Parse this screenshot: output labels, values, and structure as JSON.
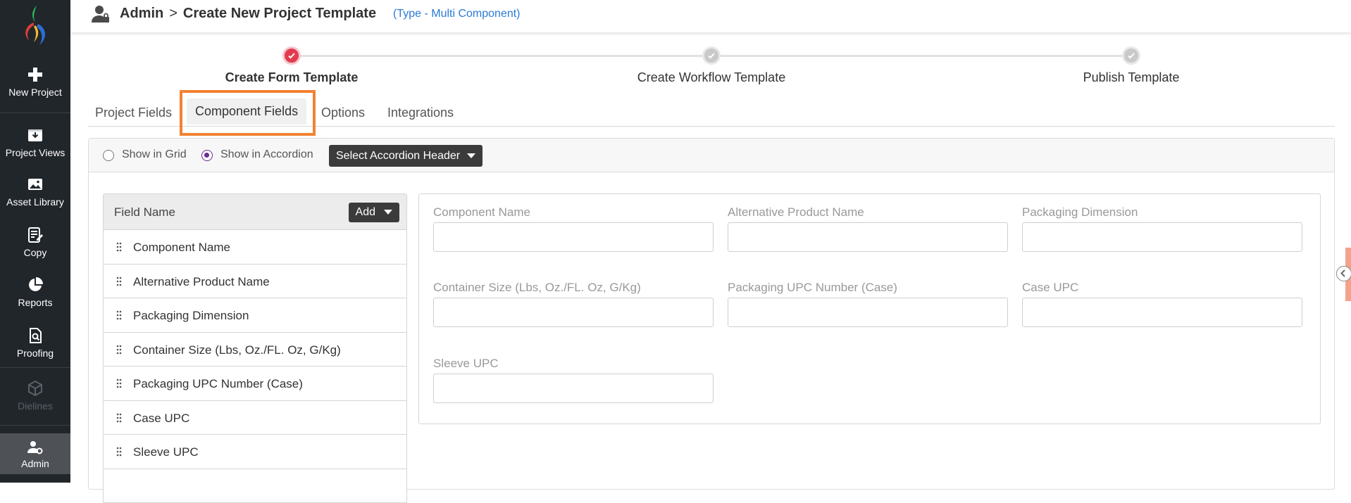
{
  "sidebar": {
    "items": [
      {
        "label": "New Project",
        "icon": "plus-icon"
      },
      {
        "label": "Project Views",
        "icon": "download-box-icon"
      },
      {
        "label": "Asset Library",
        "icon": "image-icon"
      },
      {
        "label": "Copy",
        "icon": "edit-document-icon"
      },
      {
        "label": "Reports",
        "icon": "pie-chart-icon"
      },
      {
        "label": "Proofing",
        "icon": "document-search-icon"
      },
      {
        "label": "Dielines",
        "icon": "box-icon"
      },
      {
        "label": "Admin",
        "icon": "user-gear-icon"
      }
    ]
  },
  "header": {
    "section": "Admin",
    "separator": ">",
    "title": "Create New Project Template",
    "type": "(Type - Multi Component)"
  },
  "stepper": {
    "steps": [
      {
        "label": "Create Form Template",
        "state": "done"
      },
      {
        "label": "Create Workflow Template",
        "state": "pending"
      },
      {
        "label": "Publish Template",
        "state": "pending"
      }
    ]
  },
  "tabs": [
    {
      "label": "Project Fields"
    },
    {
      "label": "Component Fields"
    },
    {
      "label": "Options"
    },
    {
      "label": "Integrations"
    }
  ],
  "toolbar": {
    "grid_label": "Show in Grid",
    "accordion_label": "Show in Accordion",
    "selected_view": "Show in Accordion",
    "accordion_header_button": "Select Accordion Header"
  },
  "field_list": {
    "header": "Field Name",
    "add_button": "Add",
    "items": [
      "Component Name",
      "Alternative Product Name",
      "Packaging Dimension",
      "Container Size (Lbs, Oz./FL. Oz, G/Kg)",
      "Packaging UPC Number (Case)",
      "Case UPC",
      "Sleeve UPC"
    ]
  },
  "preview": {
    "fields": [
      {
        "label": "Component Name",
        "value": ""
      },
      {
        "label": "Alternative Product Name",
        "value": ""
      },
      {
        "label": "Packaging Dimension",
        "value": ""
      },
      {
        "label": "Container Size (Lbs, Oz./FL. Oz, G/Kg)",
        "value": ""
      },
      {
        "label": "Packaging UPC Number (Case)",
        "value": ""
      },
      {
        "label": "Case UPC",
        "value": ""
      },
      {
        "label": "Sleeve UPC",
        "value": ""
      }
    ]
  },
  "colors": {
    "sidebar_bg": "#21262b",
    "accent_done": "#e23b4f",
    "type_link": "#2a7ad5",
    "highlight": "#f28232",
    "radio_on": "#6b2d8f"
  }
}
